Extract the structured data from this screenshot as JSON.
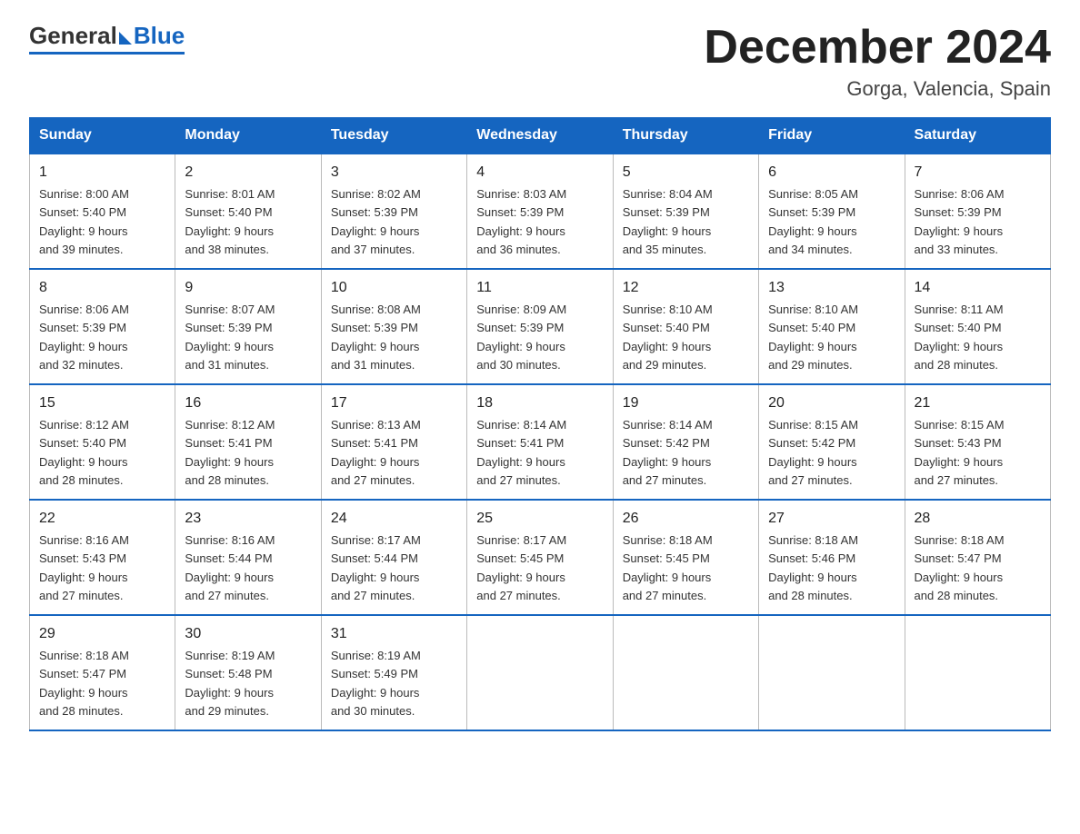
{
  "header": {
    "logo_general": "General",
    "logo_blue": "Blue",
    "month_title": "December 2024",
    "location": "Gorga, Valencia, Spain"
  },
  "weekdays": [
    "Sunday",
    "Monday",
    "Tuesday",
    "Wednesday",
    "Thursday",
    "Friday",
    "Saturday"
  ],
  "rows": [
    [
      {
        "day": "1",
        "sunrise": "8:00 AM",
        "sunset": "5:40 PM",
        "daylight": "9 hours and 39 minutes."
      },
      {
        "day": "2",
        "sunrise": "8:01 AM",
        "sunset": "5:40 PM",
        "daylight": "9 hours and 38 minutes."
      },
      {
        "day": "3",
        "sunrise": "8:02 AM",
        "sunset": "5:39 PM",
        "daylight": "9 hours and 37 minutes."
      },
      {
        "day": "4",
        "sunrise": "8:03 AM",
        "sunset": "5:39 PM",
        "daylight": "9 hours and 36 minutes."
      },
      {
        "day": "5",
        "sunrise": "8:04 AM",
        "sunset": "5:39 PM",
        "daylight": "9 hours and 35 minutes."
      },
      {
        "day": "6",
        "sunrise": "8:05 AM",
        "sunset": "5:39 PM",
        "daylight": "9 hours and 34 minutes."
      },
      {
        "day": "7",
        "sunrise": "8:06 AM",
        "sunset": "5:39 PM",
        "daylight": "9 hours and 33 minutes."
      }
    ],
    [
      {
        "day": "8",
        "sunrise": "8:06 AM",
        "sunset": "5:39 PM",
        "daylight": "9 hours and 32 minutes."
      },
      {
        "day": "9",
        "sunrise": "8:07 AM",
        "sunset": "5:39 PM",
        "daylight": "9 hours and 31 minutes."
      },
      {
        "day": "10",
        "sunrise": "8:08 AM",
        "sunset": "5:39 PM",
        "daylight": "9 hours and 31 minutes."
      },
      {
        "day": "11",
        "sunrise": "8:09 AM",
        "sunset": "5:39 PM",
        "daylight": "9 hours and 30 minutes."
      },
      {
        "day": "12",
        "sunrise": "8:10 AM",
        "sunset": "5:40 PM",
        "daylight": "9 hours and 29 minutes."
      },
      {
        "day": "13",
        "sunrise": "8:10 AM",
        "sunset": "5:40 PM",
        "daylight": "9 hours and 29 minutes."
      },
      {
        "day": "14",
        "sunrise": "8:11 AM",
        "sunset": "5:40 PM",
        "daylight": "9 hours and 28 minutes."
      }
    ],
    [
      {
        "day": "15",
        "sunrise": "8:12 AM",
        "sunset": "5:40 PM",
        "daylight": "9 hours and 28 minutes."
      },
      {
        "day": "16",
        "sunrise": "8:12 AM",
        "sunset": "5:41 PM",
        "daylight": "9 hours and 28 minutes."
      },
      {
        "day": "17",
        "sunrise": "8:13 AM",
        "sunset": "5:41 PM",
        "daylight": "9 hours and 27 minutes."
      },
      {
        "day": "18",
        "sunrise": "8:14 AM",
        "sunset": "5:41 PM",
        "daylight": "9 hours and 27 minutes."
      },
      {
        "day": "19",
        "sunrise": "8:14 AM",
        "sunset": "5:42 PM",
        "daylight": "9 hours and 27 minutes."
      },
      {
        "day": "20",
        "sunrise": "8:15 AM",
        "sunset": "5:42 PM",
        "daylight": "9 hours and 27 minutes."
      },
      {
        "day": "21",
        "sunrise": "8:15 AM",
        "sunset": "5:43 PM",
        "daylight": "9 hours and 27 minutes."
      }
    ],
    [
      {
        "day": "22",
        "sunrise": "8:16 AM",
        "sunset": "5:43 PM",
        "daylight": "9 hours and 27 minutes."
      },
      {
        "day": "23",
        "sunrise": "8:16 AM",
        "sunset": "5:44 PM",
        "daylight": "9 hours and 27 minutes."
      },
      {
        "day": "24",
        "sunrise": "8:17 AM",
        "sunset": "5:44 PM",
        "daylight": "9 hours and 27 minutes."
      },
      {
        "day": "25",
        "sunrise": "8:17 AM",
        "sunset": "5:45 PM",
        "daylight": "9 hours and 27 minutes."
      },
      {
        "day": "26",
        "sunrise": "8:18 AM",
        "sunset": "5:45 PM",
        "daylight": "9 hours and 27 minutes."
      },
      {
        "day": "27",
        "sunrise": "8:18 AM",
        "sunset": "5:46 PM",
        "daylight": "9 hours and 28 minutes."
      },
      {
        "day": "28",
        "sunrise": "8:18 AM",
        "sunset": "5:47 PM",
        "daylight": "9 hours and 28 minutes."
      }
    ],
    [
      {
        "day": "29",
        "sunrise": "8:18 AM",
        "sunset": "5:47 PM",
        "daylight": "9 hours and 28 minutes."
      },
      {
        "day": "30",
        "sunrise": "8:19 AM",
        "sunset": "5:48 PM",
        "daylight": "9 hours and 29 minutes."
      },
      {
        "day": "31",
        "sunrise": "8:19 AM",
        "sunset": "5:49 PM",
        "daylight": "9 hours and 30 minutes."
      },
      null,
      null,
      null,
      null
    ]
  ]
}
